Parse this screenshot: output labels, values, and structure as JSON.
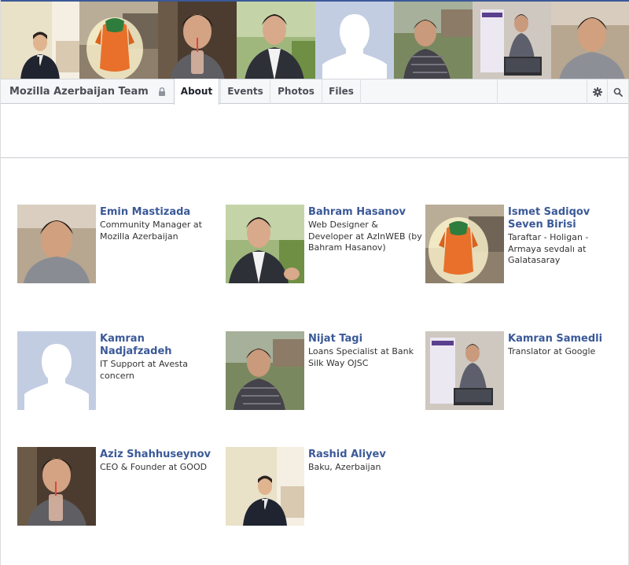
{
  "group": {
    "name": "Mozilla Azerbaijan Team"
  },
  "tabs": [
    {
      "label": "About",
      "active": true
    },
    {
      "label": "Events",
      "active": false
    },
    {
      "label": "Photos",
      "active": false
    },
    {
      "label": "Files",
      "active": false
    }
  ],
  "icons": {
    "lock": "lock-icon",
    "settings": "gear-icon",
    "search": "search-icon"
  },
  "colors": {
    "link": "#3b5998",
    "header_bg": "#f6f7f9",
    "border": "#c9ccd1"
  },
  "members": [
    {
      "name": "Emin Mastizada",
      "desc": "Community Manager at Mozilla Azerbaijan"
    },
    {
      "name": "Bahram Hasanov",
      "desc": "Web Designer & Developer at AzInWEB (by Bahram Hasanov)"
    },
    {
      "name": "Ismet Sadiqov Seven Birisi",
      "desc": "Taraftar - Holigan - Armaya sevdalı at Galatasaray"
    },
    {
      "name": "Kamran Nadjafzadeh",
      "desc": "IT Support at Avesta concern"
    },
    {
      "name": "Nijat Tagi",
      "desc": "Loans Specialist at Bank Silk Way OJSC"
    },
    {
      "name": "Kamran Samedli",
      "desc": "Translator at Google"
    },
    {
      "name": "Aziz Shahhuseynov",
      "desc": "CEO & Founder at GOOD"
    },
    {
      "name": "Rashid Aliyev",
      "desc": "Baku, Azerbaijan"
    }
  ]
}
